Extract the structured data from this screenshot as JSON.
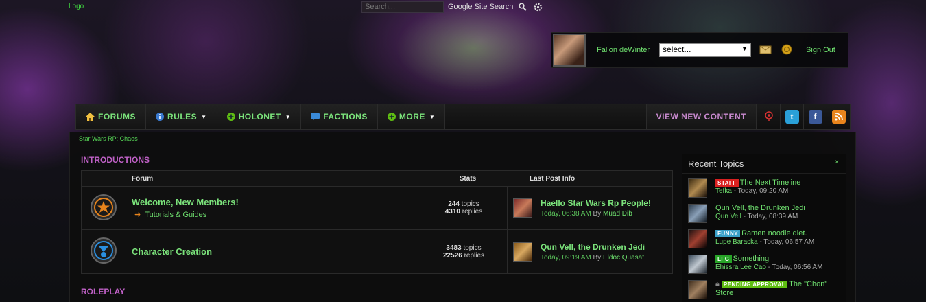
{
  "header": {
    "logo": "Logo",
    "search_placeholder": "Search...",
    "search_scope": "Google Site Search"
  },
  "user": {
    "name": "Fallon deWinter",
    "select_value": "select...",
    "sign_out": "Sign Out"
  },
  "nav": {
    "items": [
      {
        "label": "FORUMS",
        "icon": "home-icon"
      },
      {
        "label": "RULES",
        "icon": "info-icon",
        "dropdown": true
      },
      {
        "label": "HOLONET",
        "icon": "plus-icon",
        "dropdown": true
      },
      {
        "label": "FACTIONS",
        "icon": "chat-icon"
      },
      {
        "label": "MORE",
        "icon": "plus-icon",
        "dropdown": true
      }
    ],
    "view_new_content": "VIEW NEW CONTENT",
    "social": [
      "map-pin-icon",
      "twitter-icon",
      "facebook-icon",
      "rss-icon"
    ]
  },
  "breadcrumb": "Star Wars RP: Chaos",
  "categories": [
    {
      "title": "INTRODUCTIONS",
      "columns": {
        "forum": "Forum",
        "stats": "Stats",
        "last": "Last Post Info"
      },
      "forums": [
        {
          "icon": "orange-emblem-icon",
          "title": "Welcome, New Members!",
          "subforum": "Tutorials & Guides",
          "topics": "244",
          "topics_label": "topics",
          "replies": "4310",
          "replies_label": "replies",
          "last_title": "Haello Star Wars Rp People!",
          "last_time": "Today, 06:38 AM",
          "last_by": "By",
          "last_user": "Muad Dib"
        },
        {
          "icon": "blue-emblem-icon",
          "title": "Character Creation",
          "subforum": "",
          "topics": "3483",
          "topics_label": "topics",
          "replies": "22526",
          "replies_label": "replies",
          "last_title": "Qun Vell, the Drunken Jedi",
          "last_time": "Today, 09:19 AM",
          "last_by": "By",
          "last_user": "Eldoc Quasat"
        }
      ]
    },
    {
      "title": "ROLEPLAY"
    }
  ],
  "recent": {
    "title": "Recent Topics",
    "close": "×",
    "topics": [
      {
        "badge": "STAFF",
        "badge_color": "#d92020",
        "title": "The Next Timeline",
        "user": "Tefka",
        "time": "- Today, 09:20 AM"
      },
      {
        "badge": "",
        "badge_color": "",
        "title": "Qun Vell, the Drunken Jedi",
        "user": "Qun Vell",
        "time": "- Today, 08:39 AM"
      },
      {
        "badge": "FUNNY",
        "badge_color": "#3aa0c8",
        "title": "Ramen noodle diet.",
        "user": "Lupe Baracka",
        "time": "- Today, 06:57 AM"
      },
      {
        "badge": "LFG",
        "badge_color": "#27a327",
        "title": "Something",
        "user": "Ehissra Lee Cao",
        "time": "- Today, 06:56 AM"
      },
      {
        "badge": "PENDING APPROVAL",
        "badge_color": "#5fbd12",
        "title": "The \"Chon\"",
        "title2": "Store",
        "user": "",
        "time": ""
      }
    ]
  },
  "colors": {
    "accent_green": "#7be37b",
    "category_purple": "#c061c7"
  }
}
